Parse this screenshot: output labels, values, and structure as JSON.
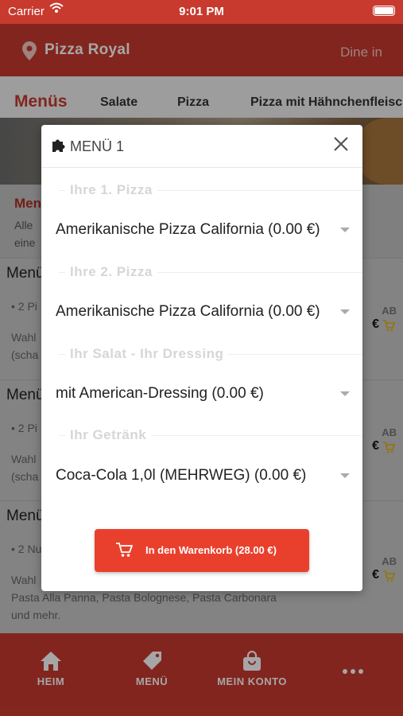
{
  "status_bar": {
    "carrier": "Carrier",
    "time": "9:01 PM"
  },
  "header": {
    "store_name": "Pizza Royal",
    "mode": "Dine in"
  },
  "tabs": [
    "Menüs",
    "Salate",
    "Pizza",
    "Pizza mit Hähnchenfleisc"
  ],
  "section": {
    "title": "Men",
    "desc_line1": "Alle",
    "desc_line2": "eine"
  },
  "menu_cards": [
    {
      "name": "Menü",
      "bullet": "• 2 Pi",
      "line1": "Wahl",
      "line2": "(scha",
      "ab": "AB",
      "price_tail": "€"
    },
    {
      "name": "Menü",
      "bullet": "• 2 Pi",
      "line1": "Wahl",
      "line2": "(scha",
      "ab": "AB",
      "price_tail": "€"
    },
    {
      "name": "Menü",
      "bullet": "• 2 Nu",
      "line1": "Wahl",
      "line2": "Pasta Alla Panna, Pasta Bolognese, Pasta Carbonara",
      "line3": "und mehr.",
      "ab": "AB",
      "price_tail": "€"
    }
  ],
  "modal": {
    "title": "MENÜ 1",
    "groups": [
      {
        "label": "Ihre 1. Pizza",
        "value": "Amerikanische Pizza California (0.00 €)"
      },
      {
        "label": "Ihre 2. Pizza",
        "value": "Amerikanische Pizza California (0.00 €)"
      },
      {
        "label": "Ihr Salat - Ihr Dressing",
        "value": "mit American-Dressing (0.00 €)"
      },
      {
        "label": "Ihr Getränk",
        "value": "Coca-Cola 1,0l (MEHRWEG) (0.00 €)"
      }
    ],
    "cta_label": "In den Warenkorb (28.00 €)"
  },
  "bottom_nav": [
    {
      "label": "HEIM",
      "icon": "home-icon"
    },
    {
      "label": "MENÜ",
      "icon": "tag-icon"
    },
    {
      "label": "MEIN KONTO",
      "icon": "bag-icon"
    },
    {
      "label": "",
      "icon": "more-icon"
    }
  ],
  "colors": {
    "brand": "#c83a2e",
    "cta": "#e9402d",
    "price_cart": "#e6b200"
  }
}
